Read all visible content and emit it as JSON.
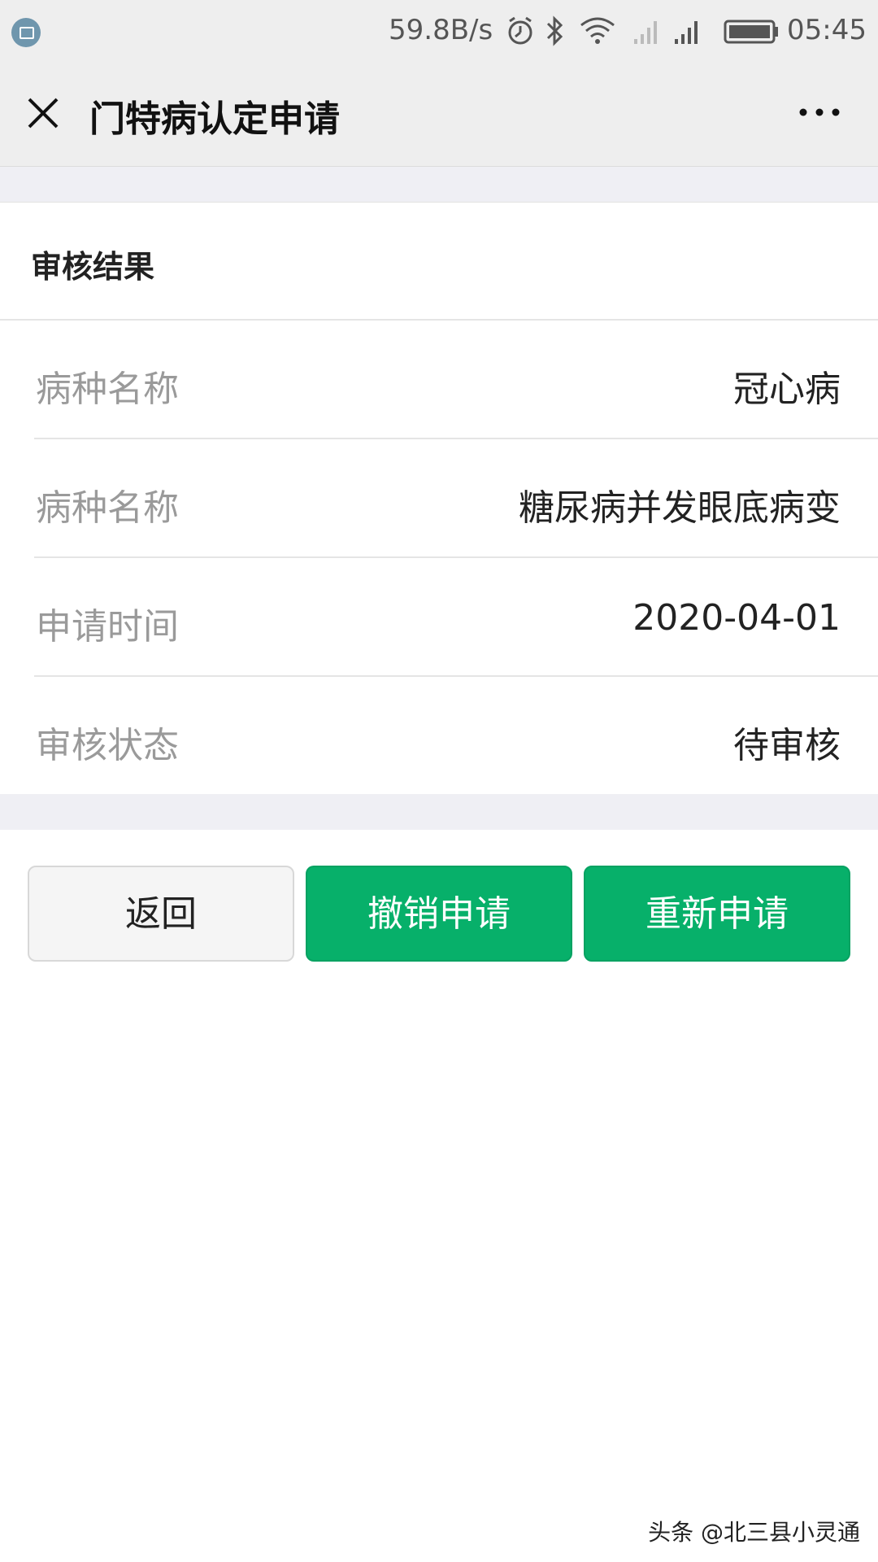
{
  "status_bar": {
    "net_speed": "59.8B/s",
    "time": "05:45",
    "icons": [
      "app-notification-icon",
      "alarm-icon",
      "bluetooth-icon",
      "wifi-icon",
      "signal-icon",
      "signal-icon",
      "battery-icon"
    ]
  },
  "header": {
    "title": "门特病认定申请",
    "close_icon": "close-icon",
    "more_icon": "more-icon"
  },
  "card": {
    "title": "审核结果",
    "rows": [
      {
        "label": "病种名称",
        "value": "冠心病"
      },
      {
        "label": "病种名称",
        "value": "糖尿病并发眼底病变"
      },
      {
        "label": "申请时间",
        "value": "2020-04-01"
      },
      {
        "label": "审核状态",
        "value": "待审核"
      }
    ]
  },
  "buttons": {
    "back": "返回",
    "cancel": "撤销申请",
    "reapply": "重新申请"
  },
  "colors": {
    "accent_green": "#07b06a",
    "header_bg": "#eeeeee"
  },
  "watermark": "头条 @北三县小灵通"
}
